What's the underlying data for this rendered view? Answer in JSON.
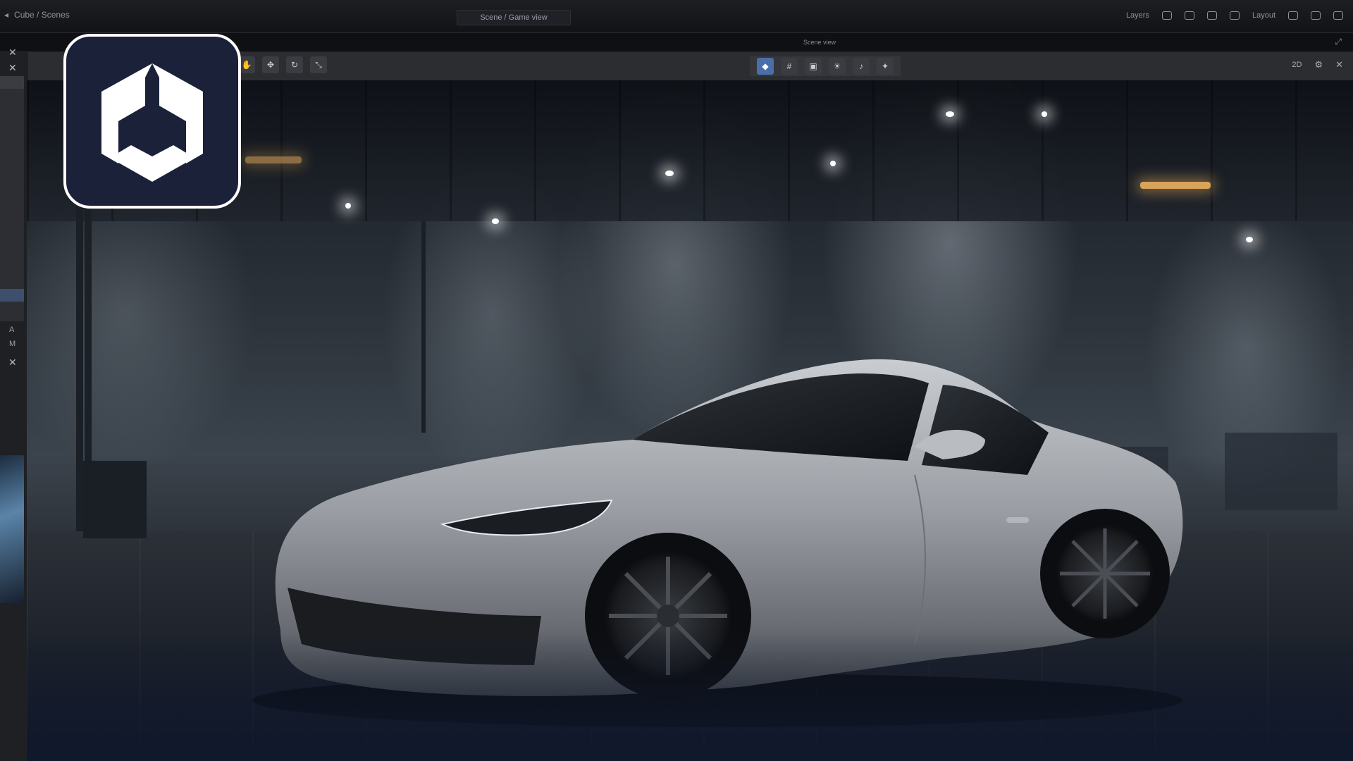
{
  "app": {
    "top_left_text": "Cube / Scenes",
    "top_center_text": "Scene / Game view",
    "top_right_text": "Layers",
    "top_right_label": "Layout",
    "sub_center_label": "Scene view"
  },
  "toolbar": {
    "left_tools": [
      "hand-tool",
      "move-tool",
      "rotate-tool",
      "scale-tool"
    ],
    "center_tools": [
      "gizmo-tool",
      "grid-tool",
      "camera-tool",
      "light-tool",
      "audio-tool",
      "fx-tool"
    ],
    "right_label": "2D"
  },
  "left_dock": {
    "label_a": "A",
    "label_b": "M"
  },
  "colors": {
    "accent": "#4a6ea8",
    "logo_bg": "#1a2138",
    "logo_border": "#ffffff",
    "car_body": "#9a9ea4"
  },
  "icons": {
    "logo": "unity-cube-logo"
  }
}
